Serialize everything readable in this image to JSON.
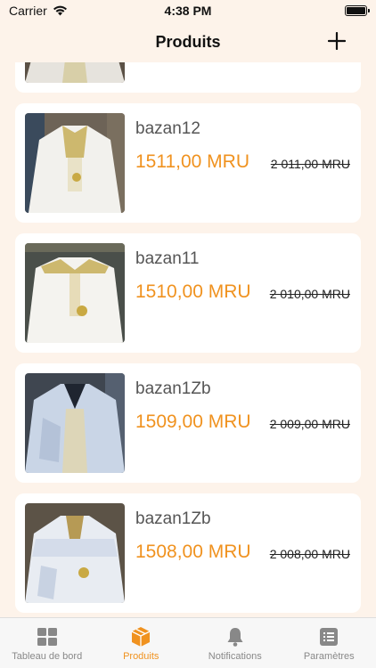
{
  "status": {
    "carrier": "Carrier",
    "time": "4:38 PM"
  },
  "nav": {
    "title": "Produits",
    "add_label": "+"
  },
  "products": [
    {
      "name": "bazan12",
      "price": "1511,00 MRU",
      "old_price": "2 011,00 MRU"
    },
    {
      "name": "bazan11",
      "price": "1510,00 MRU",
      "old_price": "2 010,00 MRU"
    },
    {
      "name": "bazan1Zb",
      "price": "1509,00 MRU",
      "old_price": "2 009,00 MRU"
    },
    {
      "name": "bazan1Zb",
      "price": "1508,00 MRU",
      "old_price": "2 008,00 MRU"
    }
  ],
  "tabs": [
    {
      "label": "Tableau de bord",
      "icon": "dashboard-icon"
    },
    {
      "label": "Produits",
      "icon": "box-icon",
      "active": true
    },
    {
      "label": "Notifications",
      "icon": "bell-icon"
    },
    {
      "label": "Paramètres",
      "icon": "settings-list-icon"
    }
  ],
  "colors": {
    "accent": "#f0921f",
    "background": "#fdf3ea",
    "card": "#ffffff"
  }
}
